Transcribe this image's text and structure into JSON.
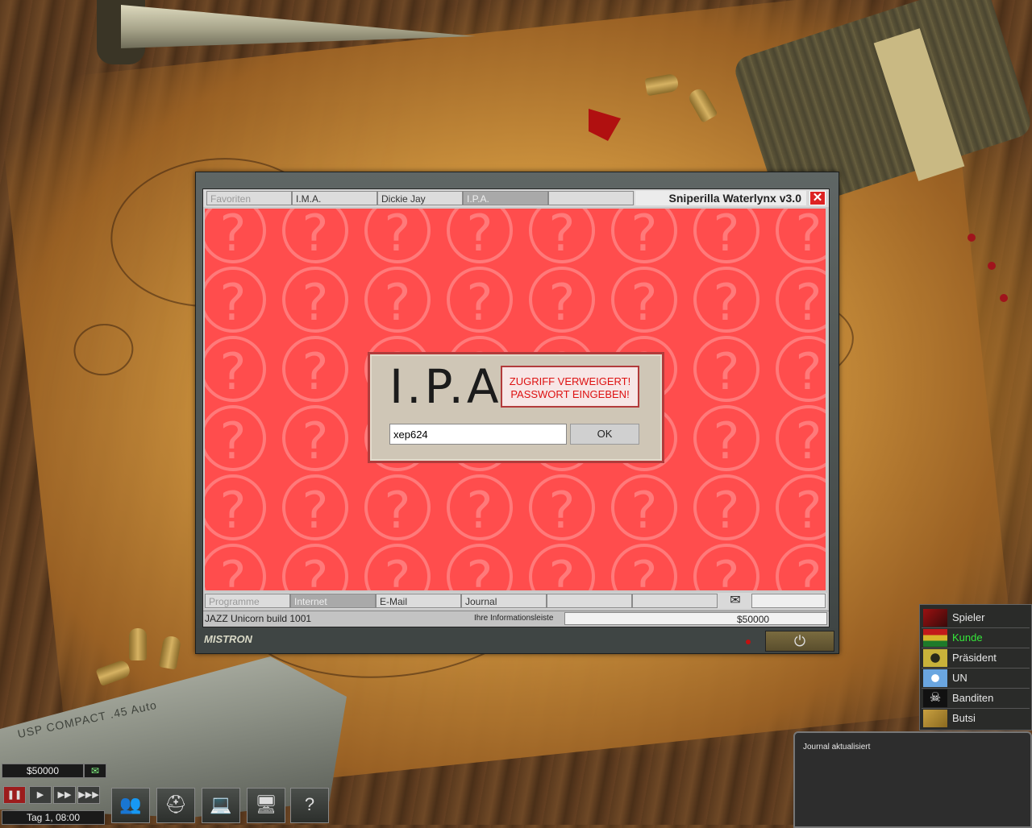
{
  "window": {
    "title": "Sniperilla Waterlynx v3.0",
    "close_symbol": "✕",
    "top_tabs": [
      {
        "label": "Favoriten"
      },
      {
        "label": "I.M.A."
      },
      {
        "label": "Dickie Jay"
      },
      {
        "label": "I.P.A."
      },
      {
        "label": ""
      }
    ],
    "bottom_tabs": [
      {
        "label": "Programme"
      },
      {
        "label": "Internet"
      },
      {
        "label": "E-Mail"
      },
      {
        "label": "Journal"
      },
      {
        "label": ""
      },
      {
        "label": ""
      }
    ],
    "mail_symbol": "✉",
    "build": "JAZZ Unicorn build 1001",
    "info_label": "Ihre Informationsleiste",
    "money": "$50000",
    "brand": "MISTRON",
    "power_symbol": "⏻"
  },
  "login": {
    "logo": "I.P.A.",
    "message_line1": "ZUGRIFF VERWEIGERT!",
    "message_line2": "PASSWORT EINGEBEN!",
    "password_value": "xep624",
    "ok_label": "OK",
    "question_mark": "?"
  },
  "factions": [
    {
      "label": "Spieler"
    },
    {
      "label": "Kunde"
    },
    {
      "label": "Präsident"
    },
    {
      "label": "UN"
    },
    {
      "label": "Banditen"
    },
    {
      "label": "Butsi"
    }
  ],
  "journal": {
    "message": "Journal aktualisiert"
  },
  "hud": {
    "cash": "$50000",
    "mail_symbol": "✉",
    "date": "Tag 1, 08:00",
    "help_symbol": "?"
  },
  "background": {
    "gun_text": "USP COMPACT .45 Auto"
  },
  "colors": {
    "content_red": "#ff4d4d",
    "error_text": "#dd1111",
    "highlight_green": "#35e83a"
  }
}
